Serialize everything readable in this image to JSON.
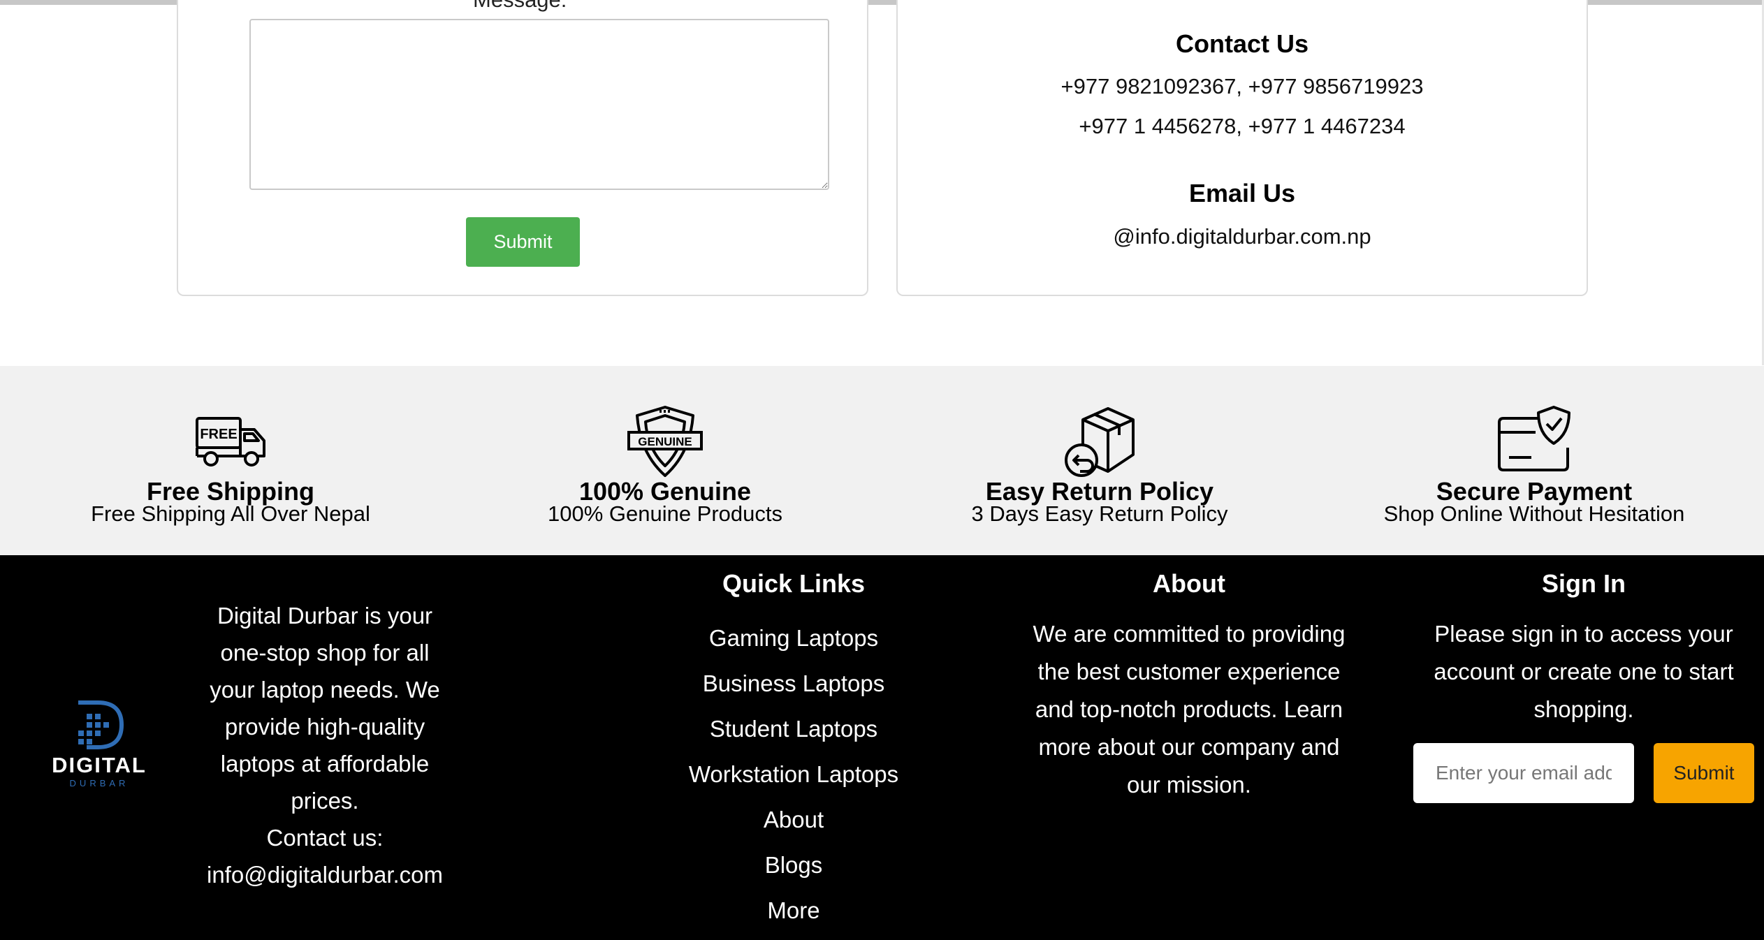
{
  "contact_form": {
    "message_label": "Message:",
    "message_value": "",
    "submit_label": "Submit"
  },
  "contact_info": {
    "contact_title": "Contact Us",
    "phone_line_1": "+977 9821092367, +977 9856719923",
    "phone_line_2": "+977 1 4456278, +977 1 4467234",
    "email_title": "Email Us",
    "email": "@info.digitaldurbar.com.np"
  },
  "features": [
    {
      "icon": "free-shipping-truck-icon",
      "title": "Free Shipping",
      "subtitle": "Free Shipping All Over Nepal",
      "badge_text": "FREE"
    },
    {
      "icon": "genuine-shield-icon",
      "title": "100% Genuine",
      "subtitle": "100% Genuine Products",
      "badge_text": "GENUINE"
    },
    {
      "icon": "return-box-icon",
      "title": "Easy Return Policy",
      "subtitle": "3 Days Easy Return Policy"
    },
    {
      "icon": "secure-card-shield-icon",
      "title": "Secure Payment",
      "subtitle": "Shop Online Without Hesitation"
    }
  ],
  "footer": {
    "logo_word": "DIGITAL",
    "logo_sub": "DURBAR",
    "about_lines": [
      "Digital Durbar is your",
      "one-stop shop for all",
      "your laptop needs. We",
      "provide high-quality",
      "laptops at affordable",
      "prices.",
      "Contact us:",
      "info@digitaldurbar.com"
    ],
    "quick_links_title": "Quick Links",
    "quick_links": [
      "Gaming Laptops",
      "Business Laptops",
      "Student Laptops",
      "Workstation Laptops",
      "About",
      "Blogs",
      "More"
    ],
    "about_title": "About",
    "about_column_lines": [
      "We are committed to providing",
      "the best customer experience",
      "and top-notch products. Learn",
      "more about our company and",
      "our mission."
    ],
    "signin_title": "Sign In",
    "signin_lines": [
      "Please sign in to access your",
      "account or create one to start",
      "shopping."
    ],
    "email_placeholder": "Enter your email address",
    "submit_label": "Submit"
  },
  "colors": {
    "submit_green": "#4caf50",
    "submit_orange": "#f7a400",
    "features_bg": "#f1f1f1",
    "footer_bg": "#000000",
    "logo_blue": "#2f6db5"
  }
}
